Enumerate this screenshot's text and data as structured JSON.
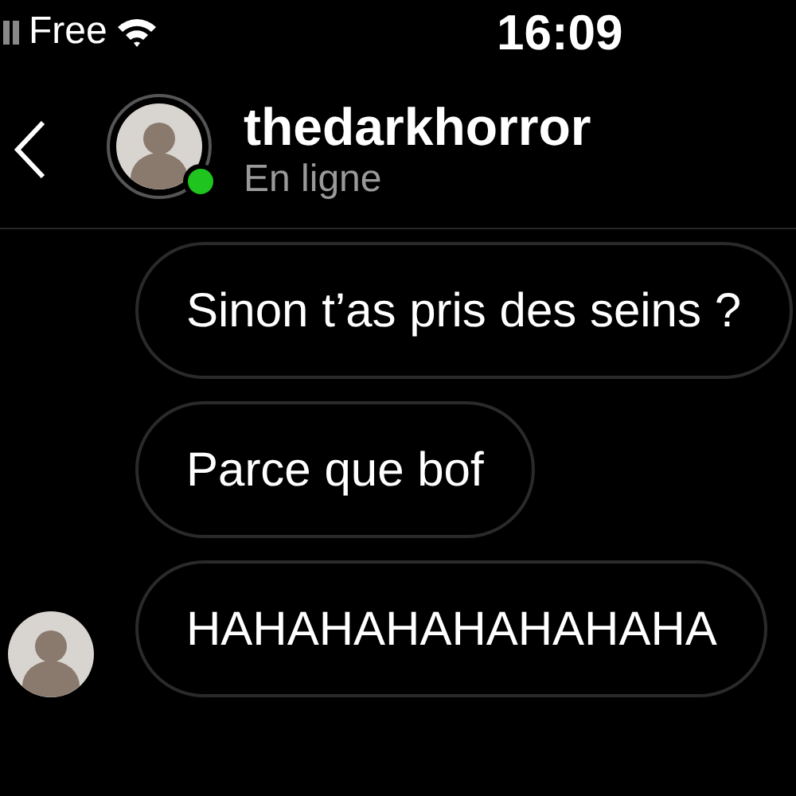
{
  "status_bar": {
    "carrier": "Free",
    "time": "16:09"
  },
  "header": {
    "username": "thedarkhorror",
    "status": "En ligne",
    "online": true
  },
  "messages": [
    {
      "text": "Sinon t’as pris des seins ?",
      "avatar": false
    },
    {
      "text": "Parce que bof",
      "avatar": false
    },
    {
      "text": "HAHAHAHAHAHAHAHA",
      "avatar": true
    }
  ]
}
